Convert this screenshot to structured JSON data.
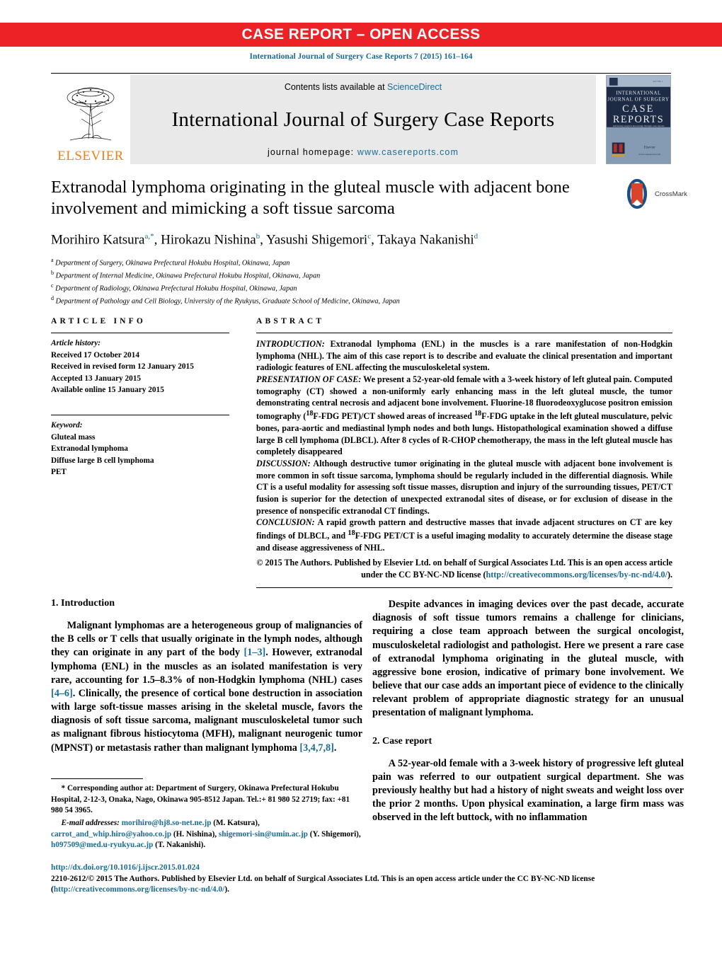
{
  "banner": {
    "text": "CASE REPORT – OPEN ACCESS"
  },
  "citation": "International Journal of Surgery Case Reports 7 (2015) 161–164",
  "journal_header": {
    "publisher": "ELSEVIER",
    "contents_prefix": "Contents lists available at ",
    "contents_link": "ScienceDirect",
    "journal_title": "International Journal of Surgery Case Reports",
    "homepage_prefix": "journal homepage: ",
    "homepage_link": "www.casereports.com",
    "cover": {
      "line1": "INTERNATIONAL",
      "line2": "JOURNAL OF SURGERY",
      "line3": "CASE",
      "line4": "REPORTS",
      "line5": "Advancing surgical knowledge through case reports",
      "line6": "www.casereports.com"
    }
  },
  "article": {
    "title": "Extranodal lymphoma originating in the gluteal muscle with adjacent bone involvement and mimicking a soft tissue sarcoma",
    "authors": [
      {
        "name": "Morihiro Katsura",
        "sup": "a,*"
      },
      {
        "name": "Hirokazu Nishina",
        "sup": "b"
      },
      {
        "name": "Yasushi Shigemori",
        "sup": "c"
      },
      {
        "name": "Takaya Nakanishi",
        "sup": "d"
      }
    ],
    "affiliations": [
      {
        "mark": "a",
        "text": "Department of Surgery, Okinawa Prefectural Hokubu Hospital, Okinawa, Japan"
      },
      {
        "mark": "b",
        "text": "Department of Internal Medicine, Okinawa Prefectural Hokubu Hospital, Okinawa, Japan"
      },
      {
        "mark": "c",
        "text": "Department of Radiology, Okinawa Prefectural Hokubu Hospital, Okinawa, Japan"
      },
      {
        "mark": "d",
        "text": "Department of Pathology and Cell Biology, University of the Ryukyus, Graduate School of Medicine, Okinawa, Japan"
      }
    ],
    "crossmark_label": "CrossMark"
  },
  "article_info": {
    "heading": "ARTICLE INFO",
    "history_label": "Article history:",
    "history": [
      "Received 17 October 2014",
      "Received in revised form 12 January 2015",
      "Accepted 13 January 2015",
      "Available online 15 January 2015"
    ],
    "keyword_label": "Keyword:",
    "keywords": [
      "Gluteal mass",
      "Extranodal lymphoma",
      "Diffuse large B cell lymphoma",
      "PET"
    ]
  },
  "abstract": {
    "heading": "ABSTRACT",
    "sections": [
      {
        "lead": "INTRODUCTION:",
        "text": " Extranodal lymphoma (ENL) in the muscles is a rare manifestation of non-Hodgkin lymphoma (NHL). The aim of this case report is to describe and evaluate the clinical presentation and important radiologic features of ENL affecting the musculoskeletal system."
      },
      {
        "lead": "PRESENTATION OF CASE:",
        "text": " We present a 52-year-old female with a 3-week history of left gluteal pain. Computed tomography (CT) showed a non-uniformly early enhancing mass in the left gluteal muscle, the tumor demonstrating central necrosis and adjacent bone involvement. Fluorine-18 fluorodeoxyglucose positron emission tomography (18F-FDG PET)/CT showed areas of increased 18F-FDG uptake in the left gluteal musculature, pelvic bones, para-aortic and mediastinal lymph nodes and both lungs. Histopathological examination showed a diffuse large B cell lymphoma (DLBCL). After 8 cycles of R-CHOP chemotherapy, the mass in the left gluteal muscle has completely disappeared"
      },
      {
        "lead": "DISCUSSION:",
        "text": " Although destructive tumor originating in the gluteal muscle with adjacent bone involvement is more common in soft tissue sarcoma, lymphoma should be regularly included in the differential diagnosis. While CT is a useful modality for assessing soft tissue masses, disruption and injury of the surrounding tissues, PET/CT fusion is superior for the detection of unexpected extranodal sites of disease, or for exclusion of disease in the presence of nonspecific extranodal CT findings."
      },
      {
        "lead": "CONCLUSION:",
        "text": " A rapid growth pattern and destructive masses that invade adjacent structures on CT are key findings of DLBCL, and 18F-FDG PET/CT is a useful imaging modality to accurately determine the disease stage and disease aggressiveness of NHL."
      }
    ],
    "copyright_prefix": "© 2015 The Authors. Published by Elsevier Ltd. on behalf of Surgical Associates Ltd. This is an open access article under the CC BY-NC-ND license (",
    "copyright_link": "http://creativecommons.org/licenses/by-nc-nd/4.0/",
    "copyright_suffix": ")."
  },
  "sections": {
    "intro_heading": "1.  Introduction",
    "intro_para1_a": "Malignant lymphomas are a heterogeneous group of malignancies of the B cells or T cells that usually originate in the lymph nodes, although they can originate in any part of the body ",
    "intro_ref1": "[1–3]",
    "intro_para1_b": ". However, extranodal lymphoma (ENL) in the muscles as an isolated manifestation is very rare, accounting for 1.5–8.3% of non-Hodgkin lymphoma (NHL) cases ",
    "intro_ref2": "[4–6]",
    "intro_para1_c": ". Clinically, the presence of cortical bone destruction in association with large soft-tissue masses arising in the skeletal muscle, favors the diagnosis of soft tissue sarcoma, malignant musculoskeletal tumor such as malignant fibrous histiocytoma (MFH), malignant neurogenic tumor (MPNST) or metastasis rather than malignant lymphoma ",
    "intro_ref3": "[3,4,7,8]",
    "intro_para1_d": ".",
    "intro_para2": "Despite advances in imaging devices over the past decade, accurate diagnosis of soft tissue tumors remains a challenge for clinicians, requiring a close team approach between the surgical oncologist, musculoskeletal radiologist and pathologist. Here we present a rare case of extranodal lymphoma originating in the gluteal muscle, with aggressive bone erosion, indicative of primary bone involvement. We believe that our case adds an important piece of evidence to the clinically relevant problem of appropriate diagnostic strategy for an unusual presentation of malignant lymphoma.",
    "case_heading": "2.  Case report",
    "case_para1": "A 52-year-old female with a 3-week history of progressive left gluteal pain was referred to our outpatient surgical department. She was previously healthy but had a history of night sweats and weight loss over the prior 2 months. Upon physical examination, a large firm mass was observed in the left buttock, with no inflammation"
  },
  "footnote": {
    "corresponding": "* Corresponding author at: Department of Surgery, Okinawa Prefectural Hokubu Hospital, 2-12-3, Onaka, Nago, Okinawa 905-8512 Japan. Tel.:+ 81 980 52 2719; fax: +81 980 54 3965.",
    "email_label": "E-mail addresses:",
    "emails": [
      {
        "addr": "morihiro@hj8.so-net.ne.jp",
        "who": " (M. Katsura),"
      },
      {
        "addr": "carrot_and_whip.hiro@yahoo.co.jp",
        "who": " (H. Nishina),"
      },
      {
        "addr": "shigemori-sin@umin.ac.jp",
        "who": " (Y. Shigemori),"
      },
      {
        "addr": "h097509@med.u-ryukyu.ac.jp",
        "who": " (T. Nakanishi)."
      }
    ]
  },
  "publisher_footer": {
    "doi": "http://dx.doi.org/10.1016/j.ijscr.2015.01.024",
    "line1": "2210-2612/© 2015 The Authors. Published by Elsevier Ltd. on behalf of Surgical Associates Ltd. This is an open access article under the CC BY-NC-ND license",
    "license_open": "(",
    "license_link": "http://creativecommons.org/licenses/by-nc-nd/4.0/",
    "license_close": ")."
  },
  "colors": {
    "banner_red": "#ec2227",
    "link_blue": "#1a6b96",
    "elsevier_orange": "#f07f1a",
    "header_grey": "#e9e9e9"
  }
}
